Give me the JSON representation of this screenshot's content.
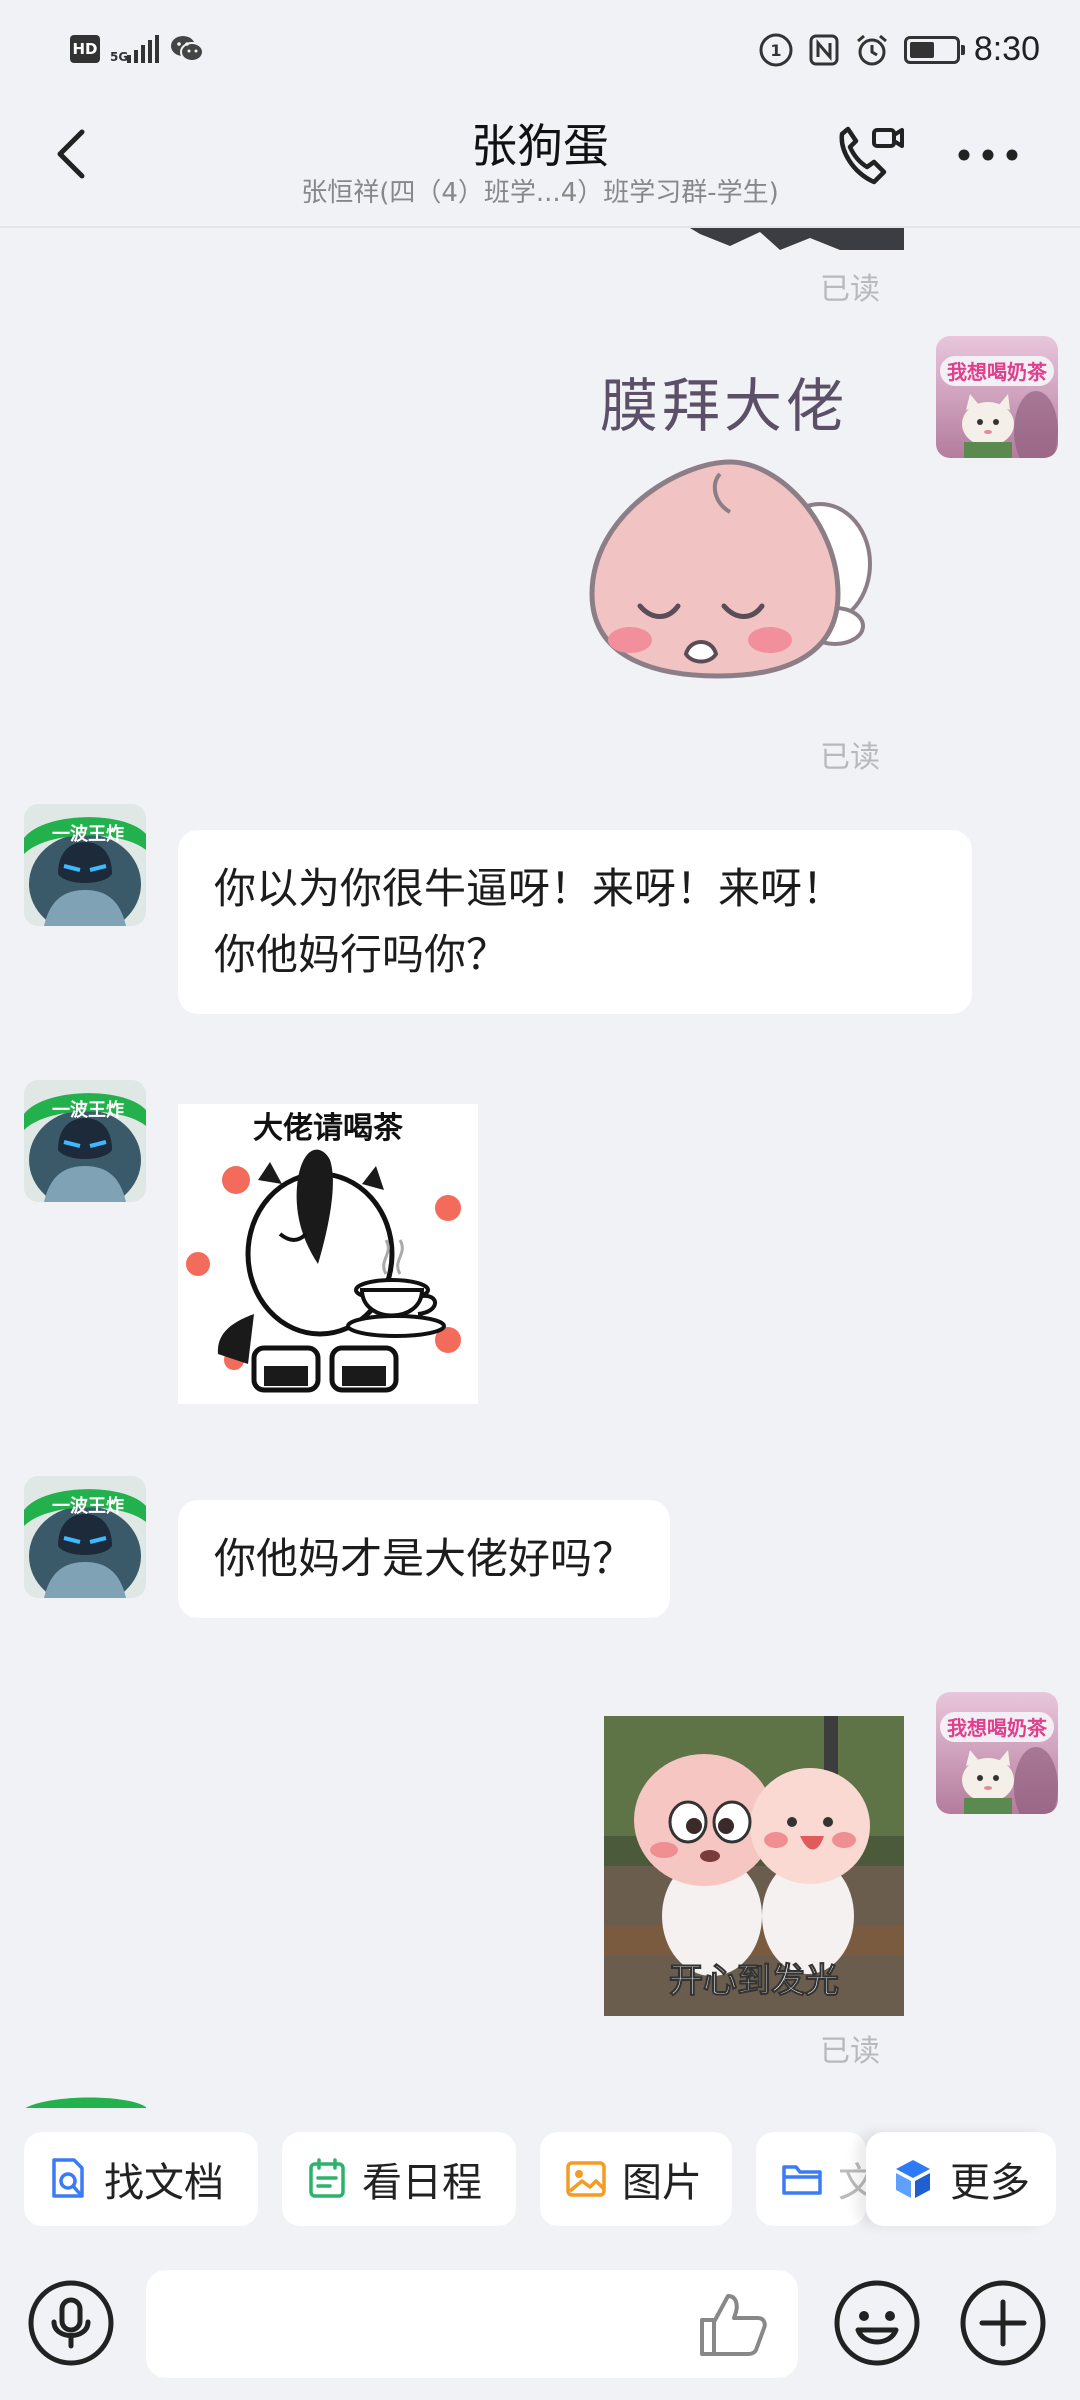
{
  "status_bar": {
    "hd_label": "HD",
    "network_label": "5G",
    "time": "8:30",
    "battery_fraction": 0.55
  },
  "header": {
    "title": "张狗蛋",
    "subtitle": "张恒祥(四（4）班学...4）班学习群-学生)",
    "icons": [
      "back-arrow-icon",
      "video-call-icon",
      "more-dots-icon"
    ]
  },
  "chat": {
    "messages": [
      {
        "from": "me",
        "kind": "sticker-partial",
        "status": "已读"
      },
      {
        "from": "me",
        "kind": "sticker",
        "sticker_text": "膜拜大佬",
        "status": "已读"
      },
      {
        "from": "contact",
        "kind": "text",
        "lines": [
          "你以为你很牛逼呀！来呀！来呀！",
          "你他妈行吗你？"
        ]
      },
      {
        "from": "contact",
        "kind": "sticker",
        "sticker_text": "大佬请喝茶"
      },
      {
        "from": "contact",
        "kind": "text",
        "lines": [
          "你他妈才是大佬好吗？"
        ]
      },
      {
        "from": "me",
        "kind": "image",
        "sticker_text": "开心到发光",
        "status": "已读"
      }
    ],
    "my_avatar_label": "我想喝奶茶",
    "contact_avatar_label": "一波王炸"
  },
  "quick_actions": [
    {
      "label": "找文档",
      "icon": "doc-search-icon",
      "color": "#3b7cf6"
    },
    {
      "label": "看日程",
      "icon": "calendar-icon",
      "color": "#2bb36b"
    },
    {
      "label": "图片",
      "icon": "image-icon",
      "color": "#f59a23"
    },
    {
      "label": "文",
      "icon": "folder-icon",
      "color": "#3b7cf6"
    },
    {
      "label": "更多",
      "icon": "more-apps-icon",
      "color": "#2f7bf5"
    }
  ],
  "input_bar": {
    "placeholder": "",
    "icons": [
      "voice-icon",
      "thumbs-up-icon",
      "emoji-icon",
      "plus-icon"
    ]
  }
}
